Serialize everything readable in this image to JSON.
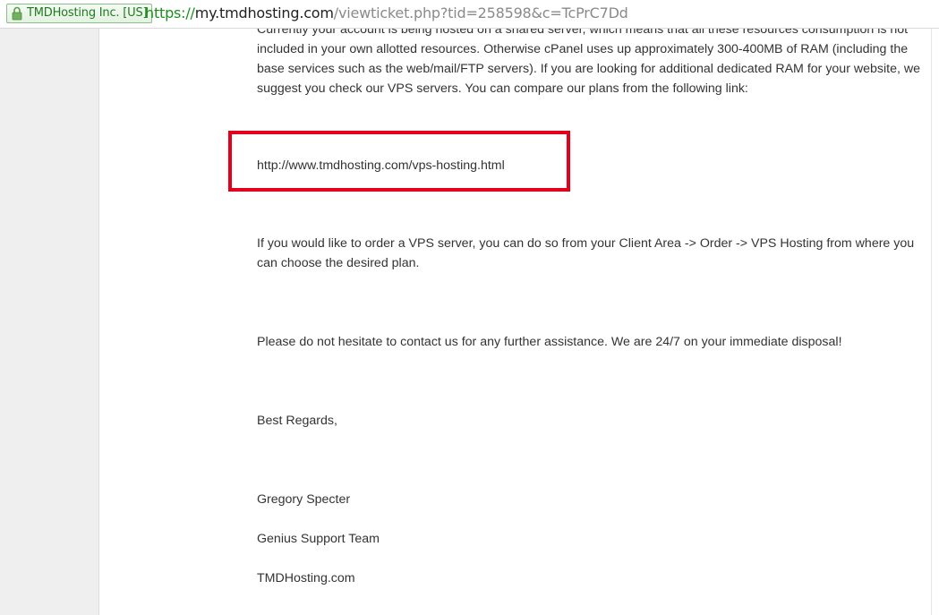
{
  "browser": {
    "certificate_badge": "TMDHosting Inc. [US]",
    "certificate_icon": "lock-icon",
    "url": {
      "scheme": "https://",
      "host": "my.tmdhosting.com",
      "path": "/viewticket.php?tid=258598&c=TcPrC7Dd"
    }
  },
  "ticket_message": {
    "paragraph_1": "Currently your account is being hosted on a shared server, which means that all these resources consumption is not included in your own allotted resources. Otherwise cPanel uses up approximately 300-400MB of RAM (including the base services such as the web/mail/FTP servers). If you are looking for additional dedicated RAM for your website, we suggest you check our VPS servers. You can compare our plans from the following link:",
    "link": "http://www.tmdhosting.com/vps-hosting.html",
    "paragraph_2": "If you would like to order a VPS server, you can do so from your Client Area -> Order -> VPS Hosting from where you can choose the desired plan.",
    "paragraph_3": "Please do not hesitate to contact us for any further assistance. We are 24/7 on your immediate disposal!",
    "closing": "Best Regards,",
    "signature_name": "Gregory Specter",
    "signature_team": "Genius Support Team",
    "signature_company": "TMDHosting.com"
  },
  "colors": {
    "highlight_border": "#e2001a",
    "secure_green": "#1b8f1b",
    "body_text": "#333333"
  }
}
